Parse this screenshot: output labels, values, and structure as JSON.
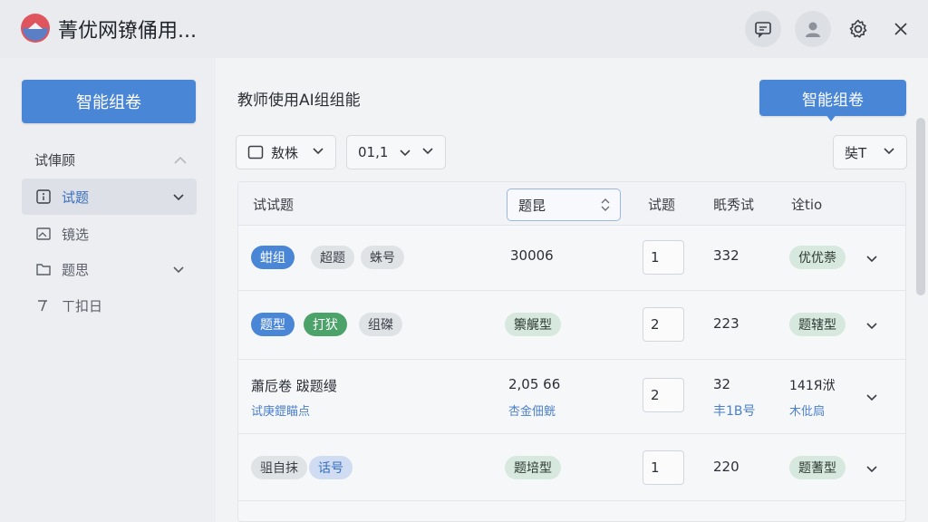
{
  "app": {
    "title": "菁优网镣俑用..."
  },
  "sidebar": {
    "primary_button": "智能组卷",
    "section_label": "试俥顾",
    "items": [
      {
        "label": "试题",
        "icon": "question-icon",
        "active": true
      },
      {
        "label": "镜选",
        "icon": "image-icon",
        "active": false
      },
      {
        "label": "题思",
        "icon": "folder-icon",
        "active": false
      },
      {
        "label": "ㄒ扣日",
        "icon": "tool-icon",
        "active": false
      }
    ]
  },
  "main": {
    "title": "教师使用AI组组能",
    "primary_button": "智能组卷",
    "filters": {
      "type": "敖株",
      "date": "01,1",
      "right": "奘T"
    },
    "table": {
      "headers": {
        "col1": "试试题",
        "sort": "题昆",
        "col3": "试题",
        "col4": "眂秀试",
        "col5": "诠tio"
      },
      "rows": [
        {
          "tags": [
            {
              "text": "蚶组",
              "style": "blue"
            },
            {
              "text": "超题",
              "style": "grey"
            },
            {
              "text": "蛛号",
              "style": "grey"
            }
          ],
          "value": "30006",
          "qty": "1",
          "score": "332",
          "status": "优优萘"
        },
        {
          "tags": [
            {
              "text": "题型",
              "style": "blue"
            },
            {
              "text": "打犾",
              "style": "green"
            },
            {
              "text": "组磔",
              "style": "grey"
            }
          ],
          "value": "籞艉型",
          "qty": "2",
          "score": "223",
          "status": "题辖型"
        },
        {
          "title": "蕭卮卷 跋题缦",
          "subtitle": "试庚鎠瞄点",
          "value": "2,05 66",
          "value_sub": "杏金佃皝",
          "qty": "2",
          "score": "32",
          "score_sub": "丰1B号",
          "status": "141Я洑",
          "status_sub": "木仳扃"
        },
        {
          "tags": [
            {
              "text": "驵自抹",
              "style": "grey"
            },
            {
              "text": "话号",
              "style": "lightblue"
            }
          ],
          "value": "题培型",
          "qty": "1",
          "score": "220",
          "status": "题蓍型"
        }
      ]
    }
  },
  "colors": {
    "accent": "#4a86d6",
    "green": "#4ba36a"
  }
}
